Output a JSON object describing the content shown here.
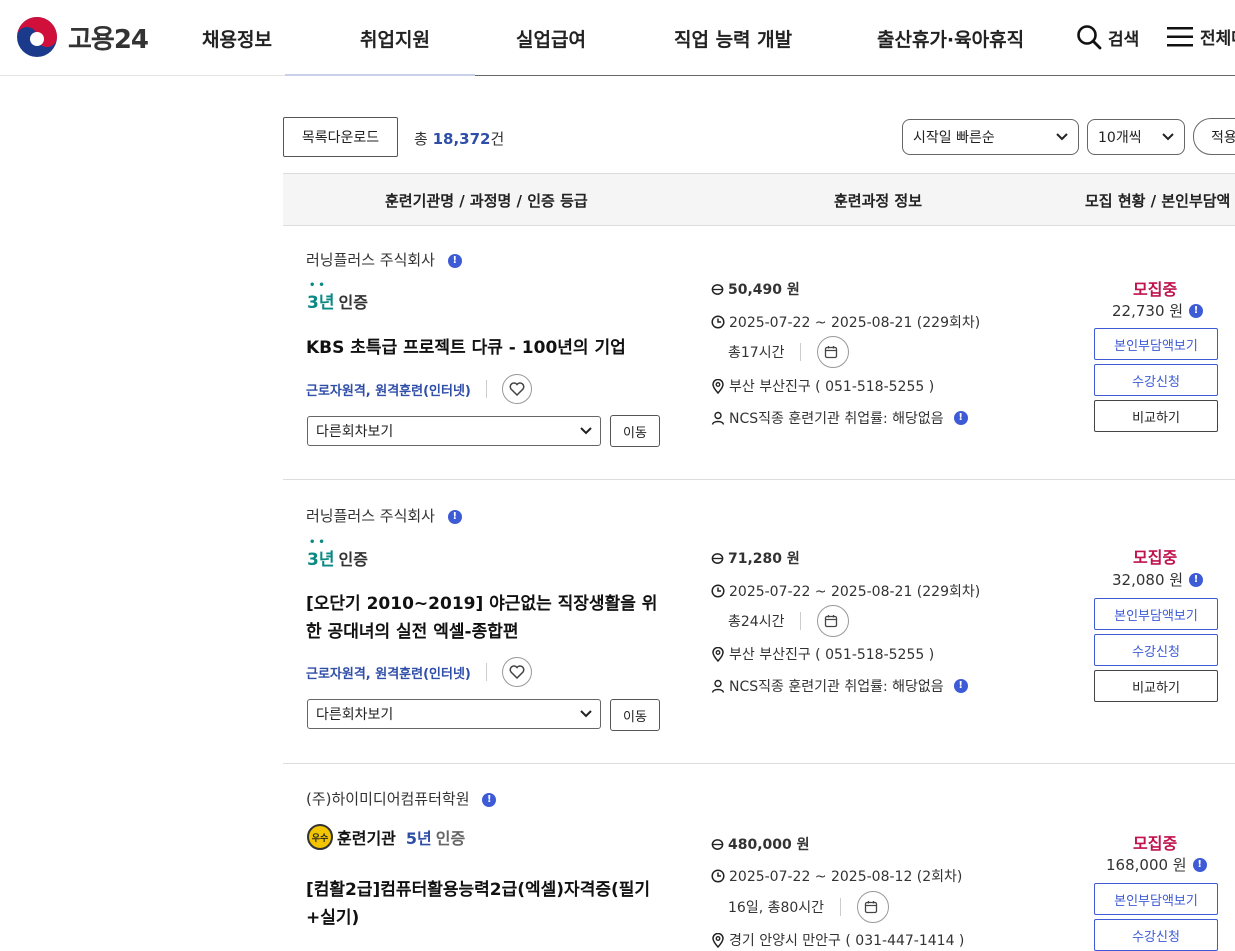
{
  "header": {
    "logo_text": "고용24",
    "nav": [
      "채용정보",
      "취업지원",
      "실업급여",
      "직업 능력 개발",
      "출산휴가·육아휴직"
    ],
    "search_label": "검색",
    "all_menu_label": "전체메뉴"
  },
  "toolbar": {
    "download_label": "목록다운로드",
    "total_prefix": "총",
    "total_count": "18,372",
    "total_suffix": "건",
    "sort_selected": "시작일 빠른순",
    "page_size_selected": "10개씩",
    "apply_label": "적용"
  },
  "table_header": {
    "col1": "훈련기관명 / 과정명 / 인증 등급",
    "col2": "훈련과정 정보",
    "col3": "모집 현황 / 본인부담액"
  },
  "courses": [
    {
      "institution": "러닝플러스 주식회사",
      "cert_year": "3년",
      "cert_label": "인증",
      "title": "KBS 초특급 프로젝트 다큐 - 100년의 기업",
      "tags": "근로자원격, 원격훈련(인터넷)",
      "round_select": "다른회차보기",
      "move_label": "이동",
      "fee": "50,490 원",
      "period": "2025-07-22 ~ 2025-08-21 (229회차)",
      "hours": "총17시간",
      "location": "부산 부산진구 ( 051-518-5255 )",
      "employment": "NCS직종 훈련기관 취업률: 해당없음",
      "status": "모집중",
      "self_fee": "22,730 원",
      "btn_self_fee": "본인부담액보기",
      "btn_apply": "수강신청",
      "btn_compare": "비교하기"
    },
    {
      "institution": "러닝플러스 주식회사",
      "cert_year": "3년",
      "cert_label": "인증",
      "title": "[오단기 2010~2019] 야근없는 직장생활을 위한 공대녀의 실전 엑셀-종합편",
      "tags": "근로자원격, 원격훈련(인터넷)",
      "round_select": "다른회차보기",
      "move_label": "이동",
      "fee": "71,280 원",
      "period": "2025-07-22 ~ 2025-08-21 (229회차)",
      "hours": "총24시간",
      "location": "부산 부산진구 ( 051-518-5255 )",
      "employment": "NCS직종 훈련기관 취업률: 해당없음",
      "status": "모집중",
      "self_fee": "32,080 원",
      "btn_self_fee": "본인부담액보기",
      "btn_apply": "수강신청",
      "btn_compare": "비교하기"
    },
    {
      "institution": "(주)하이미디어컴퓨터학원",
      "badge_label": "우수",
      "org_label": "훈련기관",
      "cert_year": "5년",
      "cert_label": "인증",
      "title": "[컴활2급]컴퓨터활용능력2급(엑셀)자격증(필기+실기)",
      "fee": "480,000 원",
      "period": "2025-07-22 ~ 2025-08-12 (2회차)",
      "hours": "16일, 총80시간",
      "location": "경기 안양시 만안구 ( 031-447-1414 )",
      "status": "모집중",
      "self_fee": "168,000 원",
      "btn_self_fee": "본인부담액보기",
      "btn_apply": "수강신청"
    }
  ],
  "colors": {
    "brand_blue": "#3d5bd6",
    "status_red": "#c0134d",
    "cert_teal": "#0b8a84"
  }
}
